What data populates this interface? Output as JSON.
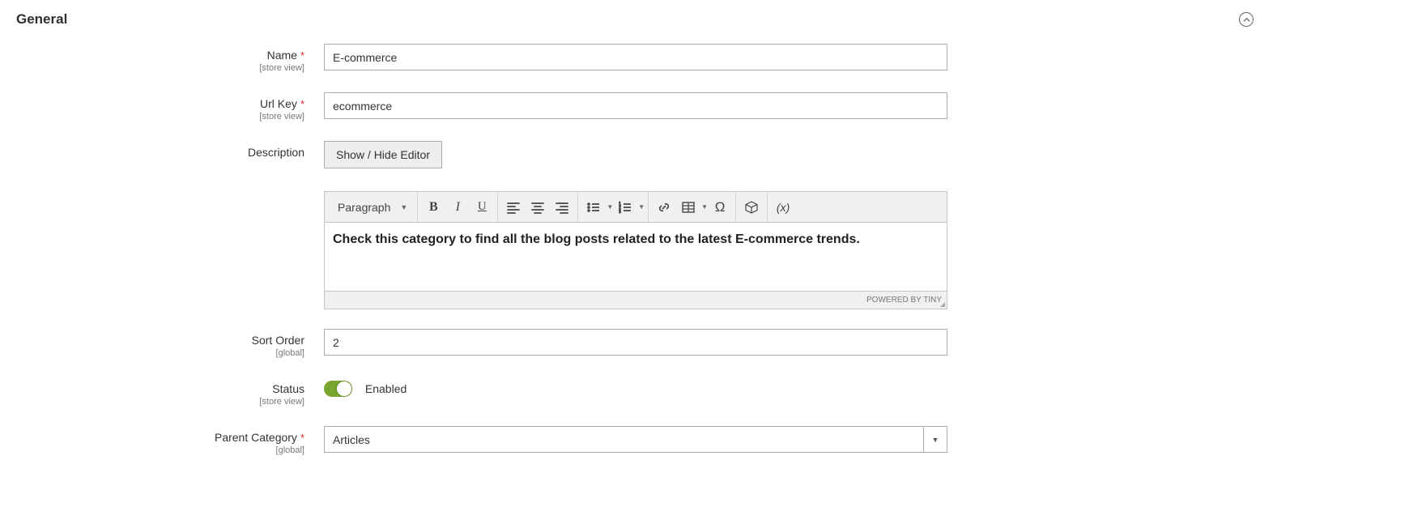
{
  "section": {
    "title": "General"
  },
  "fields": {
    "name": {
      "label": "Name",
      "scope": "[store view]",
      "value": "E-commerce",
      "required": true
    },
    "urlkey": {
      "label": "Url Key",
      "scope": "[store view]",
      "value": "ecommerce",
      "required": true
    },
    "description": {
      "label": "Description",
      "toggle_button": "Show / Hide Editor",
      "format_label": "Paragraph",
      "content": "Check this category to find all the blog posts related to the latest E-commerce trends.",
      "footer": "POWERED BY TINY"
    },
    "sortorder": {
      "label": "Sort Order",
      "scope": "[global]",
      "value": "2"
    },
    "status": {
      "label": "Status",
      "scope": "[store view]",
      "state": "Enabled"
    },
    "parent": {
      "label": "Parent Category",
      "scope": "[global]",
      "value": "Articles",
      "required": true
    }
  },
  "editor_icons": {
    "bold": "B",
    "italic": "I",
    "underline": "U",
    "variable": "(x)"
  }
}
